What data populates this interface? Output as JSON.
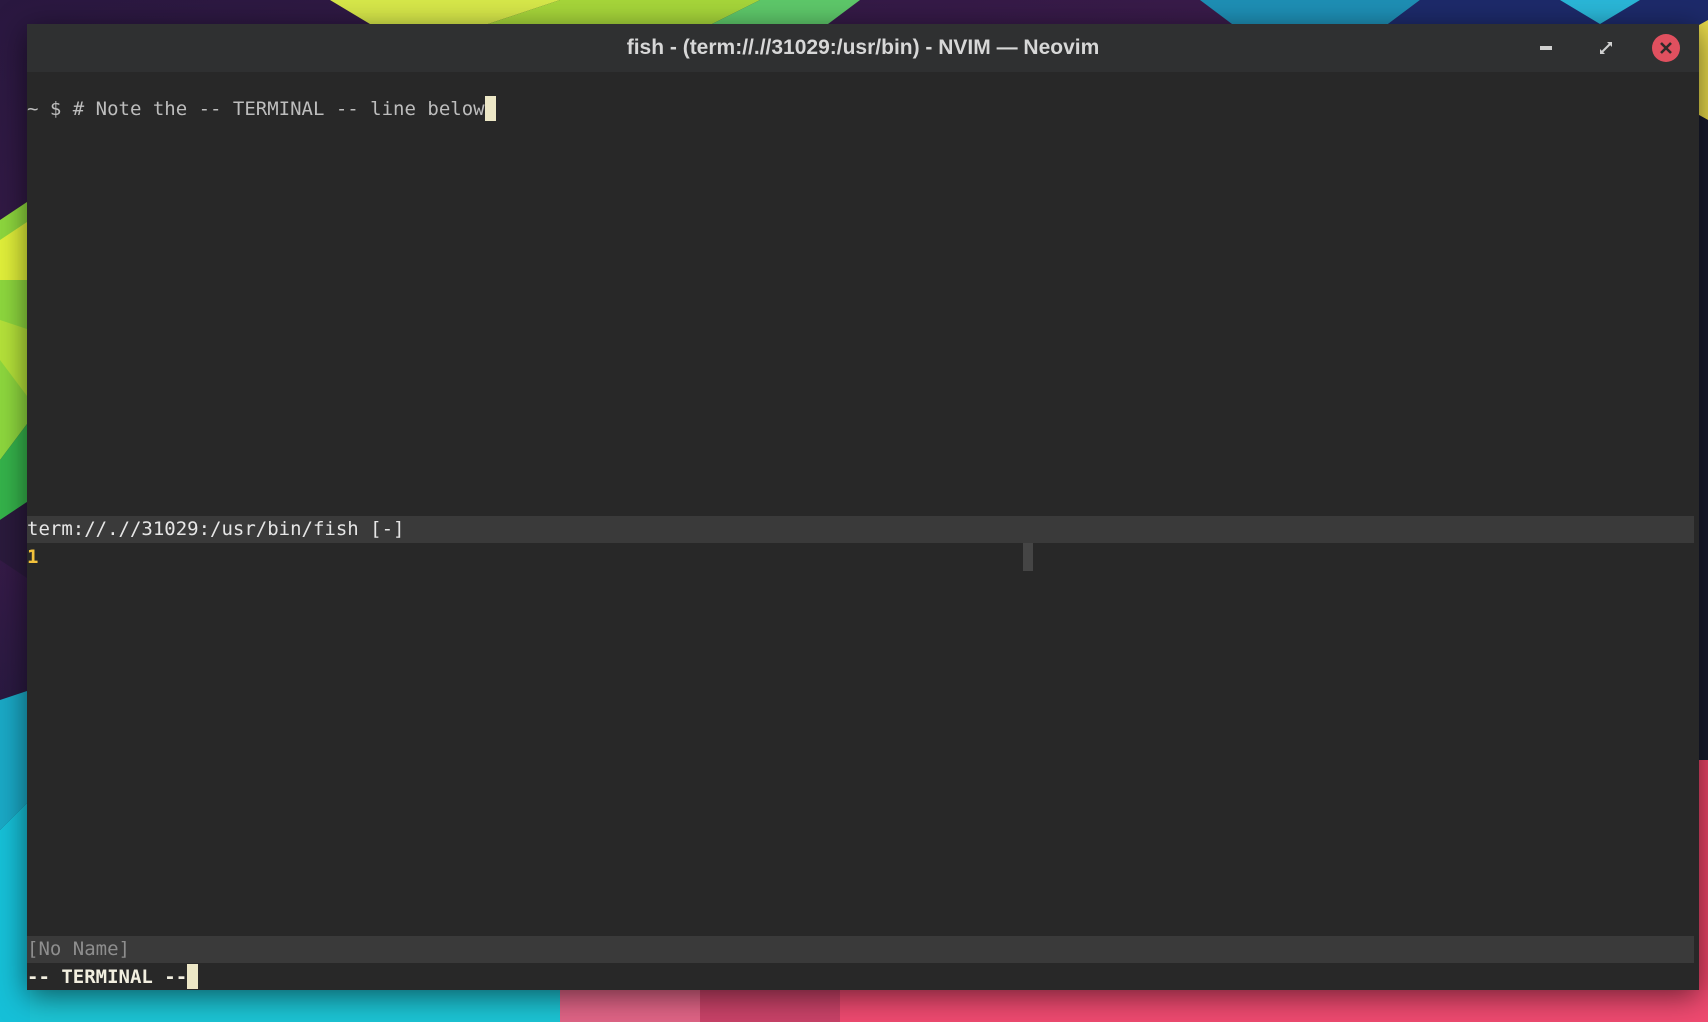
{
  "window": {
    "title": "fish - (term://.//31029:/usr/bin) - NVIM — Neovim",
    "controls": {
      "minimize": "minimize",
      "maximize": "maximize",
      "close": "close"
    }
  },
  "terminal": {
    "prompt_symbol": "~ $ ",
    "command_text": "# Note the -- TERMINAL -- line below",
    "buffer_status": "term://.//31029:/usr/bin/fish [-]",
    "line_number": "1",
    "no_name_status": "[No Name]",
    "mode_indicator": "-- TERMINAL --"
  },
  "colors": {
    "close_button": "#e0505f",
    "line_number": "#f3c23c",
    "cursor": "#ece7c6",
    "status_bar": "#3a3a3a",
    "terminal_bg": "#282828"
  },
  "icons": {
    "minimize": "minimize-icon",
    "maximize": "maximize-icon",
    "close": "close-icon"
  }
}
